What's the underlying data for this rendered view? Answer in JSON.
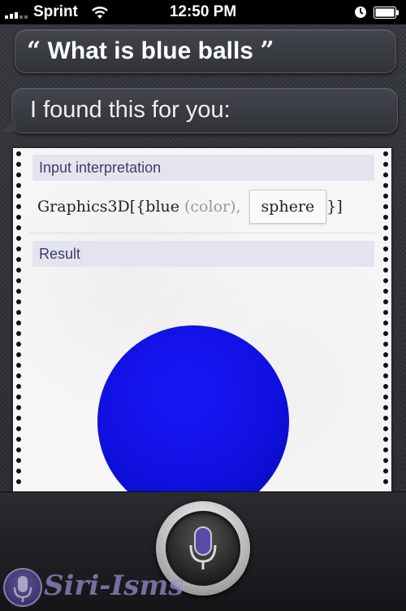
{
  "status_bar": {
    "carrier": "Sprint",
    "time": "12:50 PM",
    "signal_bars": 3,
    "icons": [
      "signal-icon",
      "wifi-icon",
      "alarm-icon",
      "battery-icon"
    ]
  },
  "conversation": {
    "user_query": "What is blue balls",
    "open_quote": "“",
    "close_quote": "”",
    "siri_reply": "I found this for you:"
  },
  "result_card": {
    "input_header": "Input interpretation",
    "input_prefix": "Graphics3D[{blue",
    "input_color_note": "(color),",
    "input_term": "sphere",
    "input_suffix": "}]",
    "result_header": "Result",
    "sphere_color": "#1414f0"
  },
  "controls": {
    "mic_icon": "microphone-icon",
    "mic_accent": "#5a4aa8"
  },
  "watermark": {
    "text": "Siri-Isms"
  }
}
